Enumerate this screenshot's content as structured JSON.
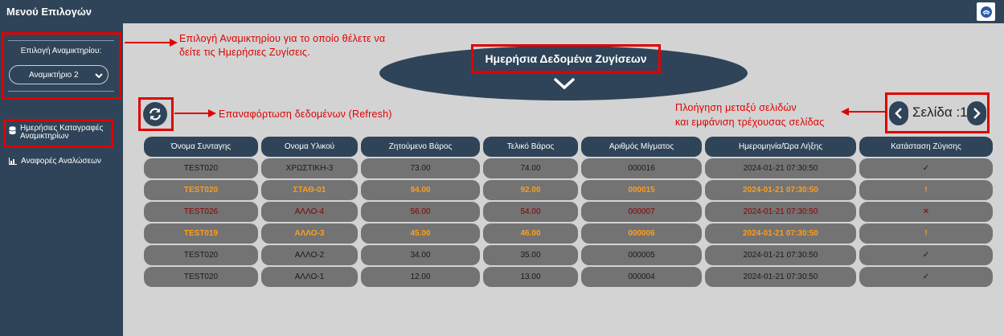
{
  "app": {
    "title": "Μενού Επιλογών"
  },
  "sidebar": {
    "selector_label": "Επιλογή Αναμικτηρίου:",
    "selected_mixer": "Αναμικτήριο 2",
    "items": [
      {
        "label_line1": "Ημερήσιες Καταγραφές",
        "label_line2": "Αναμικτηρίων",
        "icon": "database-icon"
      },
      {
        "label": "Αναφορές Αναλώσεων",
        "icon": "chart-icon"
      }
    ]
  },
  "annotations": {
    "mixer_line1": "Επιλογή Αναμικτηρίου για το οποίο θέλετε να",
    "mixer_line2": "δείτε τις Ημερήσιες Ζυγίσεις.",
    "refresh": "Επαναφόρτωση δεδομένων (Refresh)",
    "paging_line1": "Πλοήγηση μεταξύ σελιδών",
    "paging_line2": "και εμφάνιση τρέχουσας σελίδας"
  },
  "main": {
    "title": "Ημερήσια Δεδομένα Ζυγίσεων",
    "page_label": "Σελίδα :1"
  },
  "table": {
    "headers": [
      "Όνομα Συνταγης",
      "Ονομα Υλικού",
      "Ζητούμενο Βάρος",
      "Τελικό Βάρος",
      "Αριθμός Μίγματος",
      "Ημερομηνία/Ώρα Λήξης",
      "Κατάσταση Ζύγισης"
    ],
    "rows": [
      {
        "recipe": "TEST020",
        "material": "ΧΡΩΣΤΙΚΗ-3",
        "target": "73.00",
        "final": "74.00",
        "batch": "000016",
        "datetime": "2024-01-21 07:30:50",
        "status": "✓"
      },
      {
        "recipe": "TEST020",
        "material": "ΣΤΑΘ-01",
        "target": "94.00",
        "final": "92.00",
        "batch": "000015",
        "datetime": "2024-01-21 07:30:50",
        "status": "!"
      },
      {
        "recipe": "TEST026",
        "material": "ΑΛΛΟ-4",
        "target": "56.00",
        "final": "54.00",
        "batch": "000007",
        "datetime": "2024-01-21 07:30:50",
        "status": "✕"
      },
      {
        "recipe": "TEST019",
        "material": "ΑΛΛΟ-3",
        "target": "45.00",
        "final": "46.00",
        "batch": "000006",
        "datetime": "2024-01-21 07:30:50",
        "status": "!"
      },
      {
        "recipe": "TEST020",
        "material": "ΑΛΛΟ-2",
        "target": "34.00",
        "final": "35.00",
        "batch": "000005",
        "datetime": "2024-01-21 07:30:50",
        "status": "✓"
      },
      {
        "recipe": "TEST020",
        "material": "ΑΛΛΟ-1",
        "target": "12.00",
        "final": "13.00",
        "batch": "000004",
        "datetime": "2024-01-21 07:30:50",
        "status": "✓"
      }
    ]
  },
  "colors": {
    "nav": "#2f4458",
    "background": "#d3d3d3",
    "cell": "#737373",
    "annotation": "#e00000",
    "warning": "#ff9d1a",
    "error": "#8b0000"
  }
}
